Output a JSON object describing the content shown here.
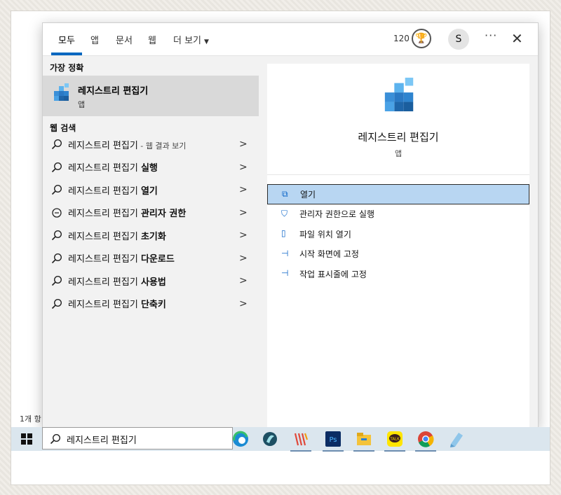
{
  "background": {
    "status_text": "1개 항"
  },
  "tabs": [
    {
      "label": "모두",
      "active": true
    },
    {
      "label": "앱"
    },
    {
      "label": "문서"
    },
    {
      "label": "웹"
    },
    {
      "label": "더 보기"
    }
  ],
  "topbar": {
    "points": "120",
    "avatar_initial": "S",
    "more": "···",
    "close": "✕"
  },
  "best_match": {
    "heading": "가장 정확",
    "title": "레지스트리 편집기",
    "subtitle": "앱"
  },
  "web_search": {
    "heading": "웹 검색",
    "items": [
      {
        "base": "레지스트리 편집기",
        "bold": "",
        "hint": " - 웹 결과 보기",
        "icon": "search-icon"
      },
      {
        "base": "레지스트리 편집기 ",
        "bold": "실행",
        "hint": "",
        "icon": "search-icon"
      },
      {
        "base": "레지스트리 편집기 ",
        "bold": "열기",
        "hint": "",
        "icon": "search-icon"
      },
      {
        "base": "레지스트리 편집기 ",
        "bold": "관리자 권한",
        "hint": "",
        "icon": "chat-bubble-icon"
      },
      {
        "base": "레지스트리 편집기 ",
        "bold": "초기화",
        "hint": "",
        "icon": "search-icon"
      },
      {
        "base": "레지스트리 편집기 ",
        "bold": "다운로드",
        "hint": "",
        "icon": "search-icon"
      },
      {
        "base": "레지스트리 편집기 ",
        "bold": "사용법",
        "hint": "",
        "icon": "search-icon"
      },
      {
        "base": "레지스트리 편집기 ",
        "bold": "단축키",
        "hint": "",
        "icon": "search-icon"
      }
    ]
  },
  "detail": {
    "title": "레지스트리 편집기",
    "subtitle": "앱",
    "actions": [
      {
        "label": "열기",
        "icon": "open-icon",
        "selected": true
      },
      {
        "label": "관리자 권한으로 실행",
        "icon": "shield-icon"
      },
      {
        "label": "파일 위치 열기",
        "icon": "file-icon"
      },
      {
        "label": "시작 화면에 고정",
        "icon": "pin-icon"
      },
      {
        "label": "작업 표시줄에 고정",
        "icon": "pin-icon"
      }
    ]
  },
  "taskbar": {
    "search_value": "레지스트리 편집기",
    "apps": [
      {
        "name": "edge-icon"
      },
      {
        "name": "app-icon"
      },
      {
        "name": "app-icon"
      },
      {
        "name": "photoshop-icon",
        "label": "Ps"
      },
      {
        "name": "file-explorer-icon"
      },
      {
        "name": "kakaotalk-icon",
        "label": "TALK"
      },
      {
        "name": "chrome-icon"
      },
      {
        "name": "notepad-icon"
      }
    ]
  }
}
